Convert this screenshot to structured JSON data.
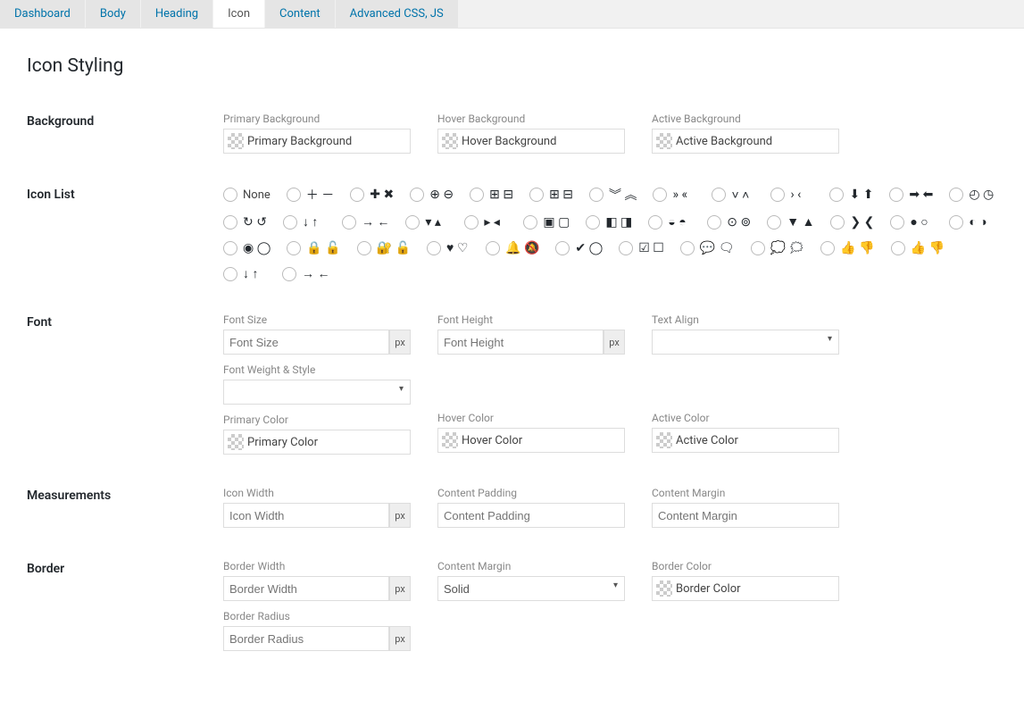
{
  "tabs": [
    {
      "label": "Dashboard"
    },
    {
      "label": "Body"
    },
    {
      "label": "Heading"
    },
    {
      "label": "Icon"
    },
    {
      "label": "Content"
    },
    {
      "label": "Advanced CSS, JS"
    }
  ],
  "active_tab": 3,
  "page_title": "Icon Styling",
  "labels": {
    "background": "Background",
    "icon_list": "Icon List",
    "font": "Font",
    "measurements": "Measurements",
    "border": "Border"
  },
  "background": {
    "primary": {
      "label": "Primary Background",
      "placeholder": "Primary Background"
    },
    "hover": {
      "label": "Hover Background",
      "placeholder": "Hover Background"
    },
    "active": {
      "label": "Active Background",
      "placeholder": "Active Background"
    }
  },
  "icon_list": {
    "none_label": "None",
    "items": [
      "none",
      "plus-minus",
      "plus-times-bold",
      "plus-minus-circle",
      "plus-minus-square",
      "plus-minus-square-outline",
      "chevrons-down-up",
      "angles-right-left",
      "chevron-down-up",
      "angle-right-left",
      "arrows-circle-down-up",
      "arrows-circle-right-left",
      "clock-in-out",
      "reload-pair",
      "arrow-down-up",
      "arrows-in-out",
      "caret-down-up",
      "play-right-left",
      "boxes-down-up",
      "boxes-left-up",
      "shields-in-out",
      "chevron-circles",
      "carets-down-up",
      "angles-bold-right-left",
      "circle-filled-outline",
      "moon-sun",
      "toggle-on-off",
      "lock-unlock",
      "lock-unlock-alt",
      "heart-filled-outline",
      "bell-filled-outline",
      "check-circles",
      "check-squares",
      "speech-bubbles",
      "chat-bubbles",
      "thumbs-up-down",
      "thumbs-hands",
      "sort-arrows",
      "exchange-arrows"
    ]
  },
  "font": {
    "size": {
      "label": "Font Size",
      "placeholder": "Font Size",
      "unit": "px"
    },
    "height": {
      "label": "Font Height",
      "placeholder": "Font Height",
      "unit": "px"
    },
    "align": {
      "label": "Text Align"
    },
    "weight": {
      "label": "Font Weight & Style"
    },
    "primary_color": {
      "label": "Primary Color",
      "placeholder": "Primary Color"
    },
    "hover_color": {
      "label": "Hover Color",
      "placeholder": "Hover Color"
    },
    "active_color": {
      "label": "Active Color",
      "placeholder": "Active Color"
    }
  },
  "measurements": {
    "icon_width": {
      "label": "Icon Width",
      "placeholder": "Icon Width",
      "unit": "px"
    },
    "content_padding": {
      "label": "Content Padding",
      "placeholder": "Content Padding"
    },
    "content_margin": {
      "label": "Content Margin",
      "placeholder": "Content Margin"
    }
  },
  "border": {
    "width": {
      "label": "Border Width",
      "placeholder": "Border Width",
      "unit": "px"
    },
    "style": {
      "label": "Content Margin",
      "value": "Solid"
    },
    "color": {
      "label": "Border Color",
      "placeholder": "Border Color"
    },
    "radius": {
      "label": "Border Radius",
      "placeholder": "Border Radius",
      "unit": "px"
    }
  }
}
